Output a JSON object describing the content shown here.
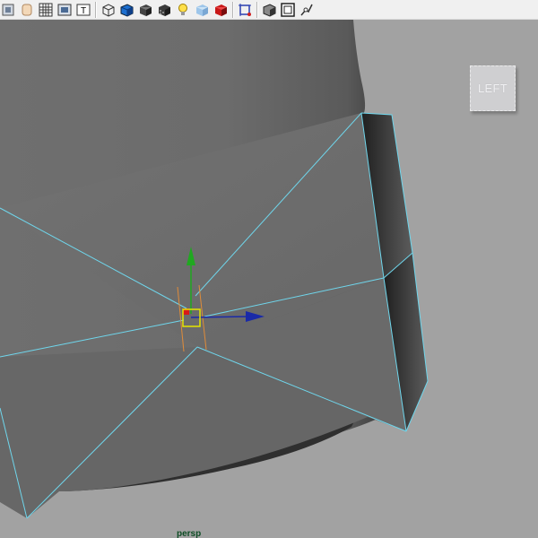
{
  "toolbar": {
    "buttons": [
      {
        "id": "select-camera",
        "icon": "camera-select-icon"
      },
      {
        "id": "image-plane",
        "icon": "image-plane-icon"
      },
      {
        "id": "grid",
        "icon": "grid-icon"
      },
      {
        "id": "film-gate",
        "icon": "film-gate-icon"
      },
      {
        "id": "resolution-gate",
        "icon": "text-gate-icon"
      },
      {
        "id": "wireframe",
        "icon": "wireframe-cube-icon"
      },
      {
        "id": "smooth-shade",
        "icon": "smooth-shade-cube-icon"
      },
      {
        "id": "default-material",
        "icon": "dark-cube-icon"
      },
      {
        "id": "textured",
        "icon": "textured-cube-icon"
      },
      {
        "id": "lights",
        "icon": "light-bulb-icon"
      },
      {
        "id": "shadows",
        "icon": "shadow-cube-icon"
      },
      {
        "id": "high-quality",
        "icon": "red-cube-icon"
      },
      {
        "id": "isolate-select",
        "icon": "isolate-select-icon"
      },
      {
        "id": "xray",
        "icon": "xray-cube-icon"
      },
      {
        "id": "wireframe-on-shaded",
        "icon": "wire-on-shaded-icon"
      },
      {
        "id": "camera-attributes",
        "icon": "camera-icon"
      }
    ]
  },
  "viewport": {
    "viewcube_label": "LEFT",
    "camera_name": "persp"
  },
  "colors": {
    "background": "#a2a2a2",
    "mesh_face": "#6d6d6d",
    "selection_edge": "#6fd6ec",
    "manipulator_x": "#1a2aa8",
    "manipulator_y": "#20a820",
    "manipulator_center": "#e5e500",
    "camera_label": "#0f4d26"
  }
}
